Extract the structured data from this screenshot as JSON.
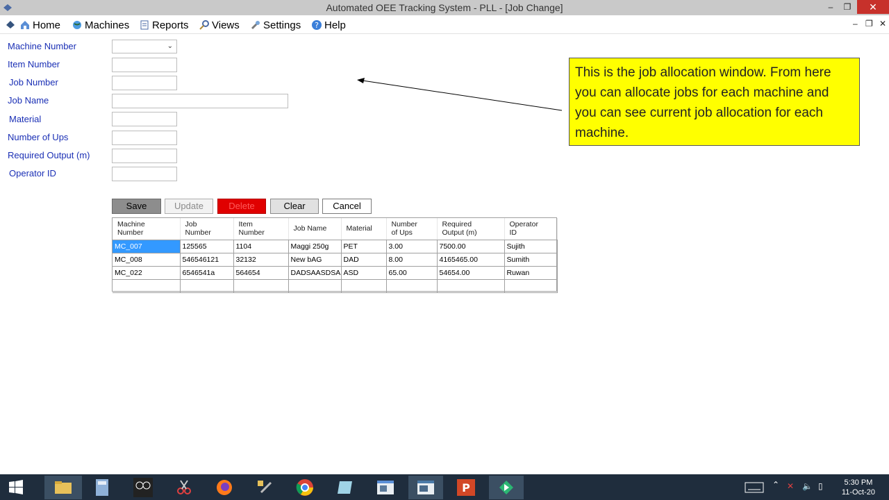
{
  "window": {
    "title": "Automated OEE Tracking System - PLL - [Job Change]",
    "minimize": "–",
    "restore": "❐",
    "close": "✕"
  },
  "menu": {
    "items": [
      {
        "label": "Home",
        "icon": "home-icon"
      },
      {
        "label": "Machines",
        "icon": "globe-icon"
      },
      {
        "label": "Reports",
        "icon": "report-icon"
      },
      {
        "label": "Views",
        "icon": "magnifier-icon"
      },
      {
        "label": "Settings",
        "icon": "wrench-icon"
      },
      {
        "label": "Help",
        "icon": "help-icon"
      }
    ],
    "mdi_minimize": "–",
    "mdi_restore": "❐",
    "mdi_close": "✕"
  },
  "form": {
    "labels": {
      "machine_number": "Machine Number",
      "item_number": "Item Number",
      "job_number": "Job Number",
      "job_name": "Job Name",
      "material": "Material",
      "number_of_ups": "Number of Ups",
      "required_output": "Required Output (m)",
      "operator_id": "Operator ID"
    },
    "values": {
      "machine_number": "",
      "item_number": "",
      "job_number": "",
      "job_name": "",
      "material": "",
      "number_of_ups": "",
      "required_output": "",
      "operator_id": ""
    }
  },
  "buttons": {
    "save": "Save",
    "update": "Update",
    "delete": "Delete",
    "clear": "Clear",
    "cancel": "Cancel"
  },
  "grid": {
    "headers": [
      [
        "Machine",
        "Number"
      ],
      [
        "Job",
        "Number"
      ],
      [
        "Item",
        "Number"
      ],
      [
        "Job Name",
        ""
      ],
      [
        "Material",
        ""
      ],
      [
        "Number",
        "of Ups"
      ],
      [
        "Required",
        "Output (m)"
      ],
      [
        "Operator",
        "ID"
      ]
    ],
    "rows": [
      [
        "MC_007",
        "125565",
        "1104",
        "Maggi 250g",
        "PET",
        "3.00",
        "7500.00",
        "Sujith"
      ],
      [
        "MC_008",
        "546546121",
        "32132",
        "New bAG",
        "DAD",
        "8.00",
        "4165465.00",
        "Sumith"
      ],
      [
        "MC_022",
        "6546541a",
        "564654",
        "DADSAASDSA",
        "ASD",
        "65.00",
        "54654.00",
        "Ruwan"
      ],
      [
        "",
        "",
        "",
        "",
        "",
        "",
        "",
        ""
      ]
    ]
  },
  "annotation": {
    "text": "This is the job allocation window. From here you can allocate jobs for each machine and you can see current job allocation for each machine."
  },
  "taskbar": {
    "clock_time": "5:30 PM",
    "clock_date": "11-Oct-20"
  },
  "colors": {
    "label": "#1a2fb5",
    "callout": "#ffff00",
    "delete_button": "#e00000",
    "selection": "#3399ff",
    "taskbar": "#1f2d3d"
  }
}
